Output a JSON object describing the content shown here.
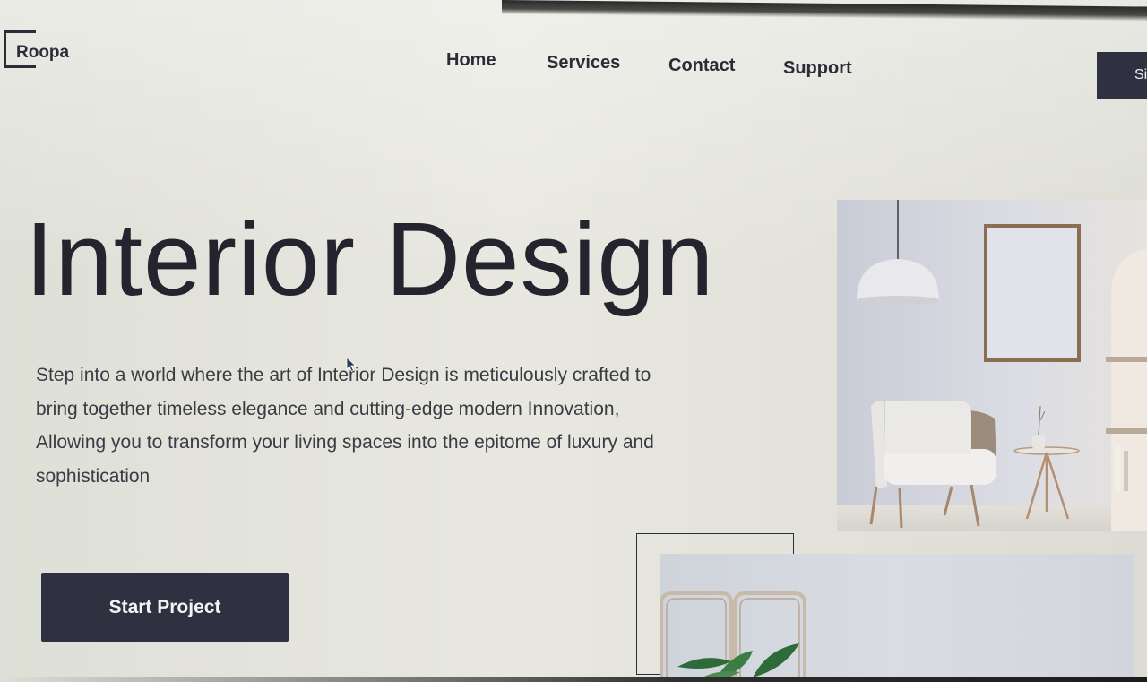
{
  "brand": {
    "name": "Roopa"
  },
  "nav": {
    "items": [
      {
        "label": "Home"
      },
      {
        "label": "Services"
      },
      {
        "label": "Contact"
      },
      {
        "label": "Support"
      }
    ],
    "signin_label": "Si"
  },
  "hero": {
    "title": "Interior Design",
    "description": "Step into a world where the art of Interior Design is meticulously crafted to bring together timeless elegance and cutting-edge modern Innovation, Allowing you to transform your living spaces into the epitome of luxury and sophistication",
    "cta_label": "Start Project"
  },
  "images": {
    "room": "lounge-chair-room-photo",
    "bottom": "window-plant-photo"
  },
  "colors": {
    "background": "#e4e4dc",
    "primary_dark": "#2f3140",
    "text": "#23242d"
  }
}
